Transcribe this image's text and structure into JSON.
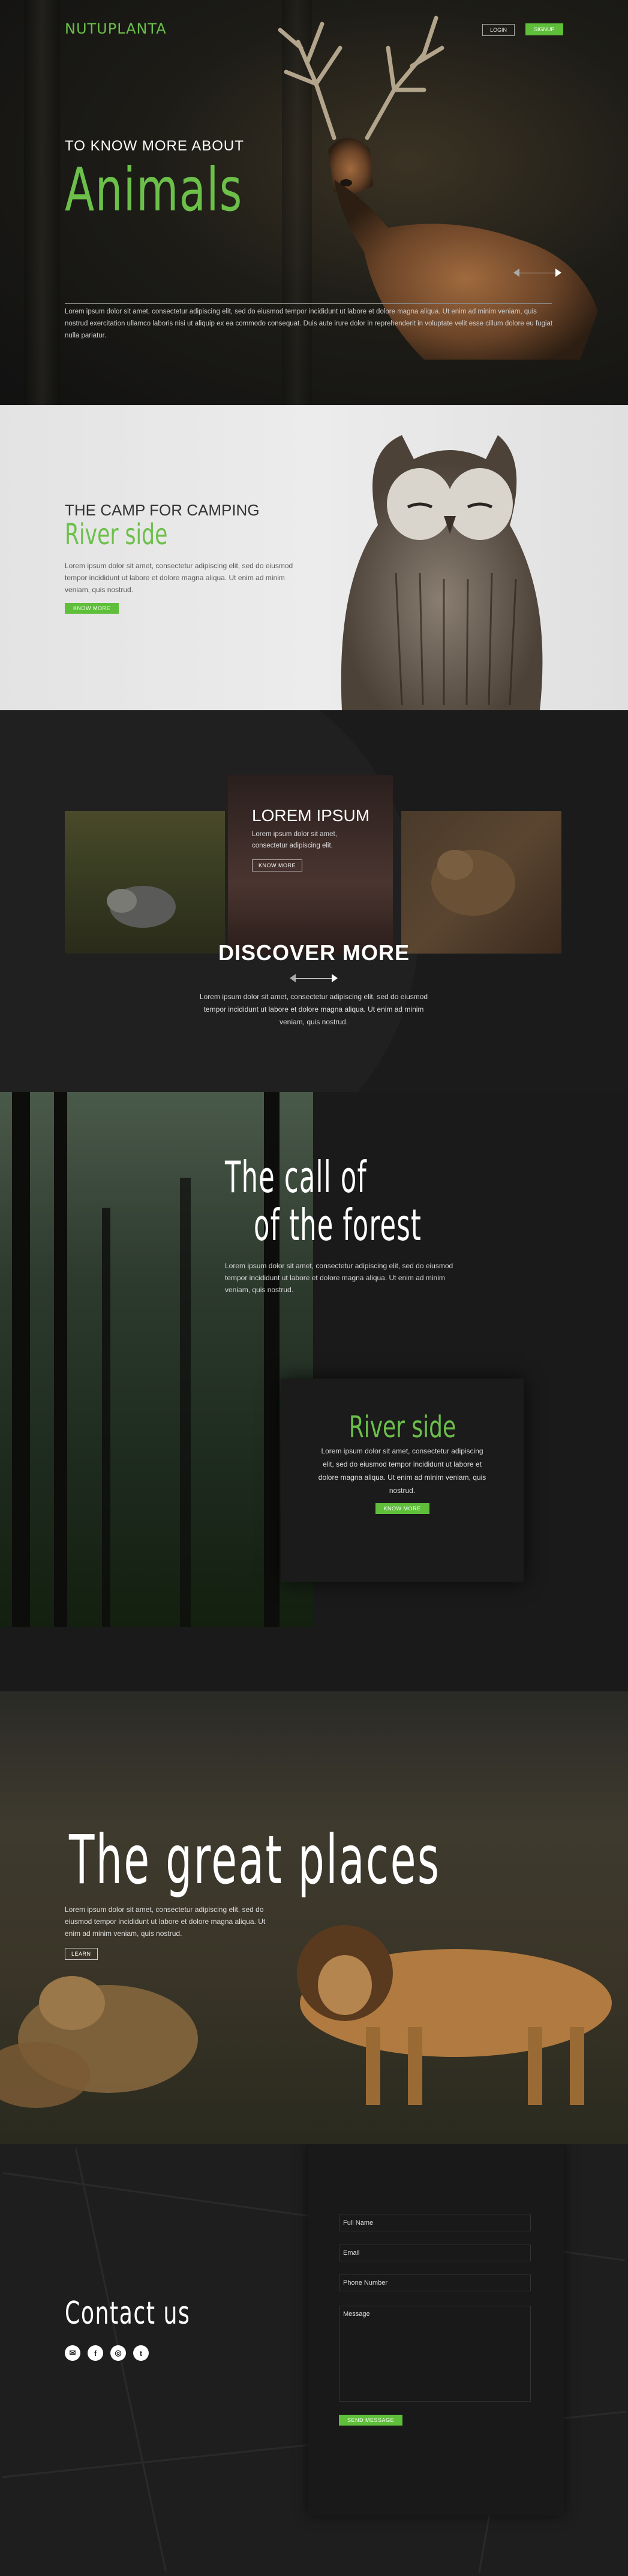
{
  "brand": {
    "logo": "NUTUPLANTA",
    "accent": "#5fbf3a"
  },
  "nav": {
    "login": "LOGIN",
    "signup": "SIGNUP"
  },
  "hero": {
    "subtitle": "TO KNOW MORE ABOUT",
    "title": "Animals",
    "paragraph": "Lorem ipsum dolor sit amet, consectetur adipiscing elit, sed do eiusmod tempor incididunt ut labore et dolore magna aliqua. Ut enim ad minim veniam, quis nostrud exercitation ullamco laboris nisi ut aliquip ex ea commodo consequat. Duis aute irure dolor in reprehenderit in voluptate velit esse cillum dolore eu fugiat nulla pariatur."
  },
  "owl": {
    "subtitle": "THE CAMP FOR CAMPING",
    "title": "River side",
    "paragraph": "Lorem ipsum dolor sit amet, consectetur adipiscing elit, sed do eiusmod tempor incididunt ut labore et dolore magna aliqua. Ut enim ad minim veniam, quis nostrud.",
    "button": "KNOW MORE"
  },
  "discover": {
    "card_title": "LOREM IPSUM",
    "card_paragraph": "Lorem ipsum dolor sit amet, consectetur adipiscing elit.",
    "card_button": "KNOW MORE",
    "title": "DISCOVER MORE",
    "paragraph": "Lorem ipsum dolor sit amet, consectetur adipiscing elit, sed do eiusmod tempor incididunt ut labore et dolore magna aliqua. Ut enim ad minim veniam, quis nostrud."
  },
  "forest": {
    "title_line1": "The call of",
    "title_line2": "of the forest",
    "paragraph": "Lorem ipsum dolor sit amet, consectetur adipiscing elit, sed do eiusmod tempor incididunt ut labore et dolore magna aliqua. Ut enim ad minim veniam, quis nostrud.",
    "box_title": "River side",
    "box_paragraph": "Lorem ipsum dolor sit amet, consectetur adipiscing elit, sed do eiusmod tempor incididunt ut labore et dolore magna aliqua. Ut enim ad minim veniam, quis nostrud.",
    "box_button": "KNOW MORE"
  },
  "places": {
    "title": "The great places",
    "paragraph": "Lorem ipsum dolor sit amet, consectetur adipiscing elit, sed do eiusmod tempor incididunt ut labore et dolore magna aliqua. Ut enim ad minim veniam, quis nostrud.",
    "button": "LEARN"
  },
  "contact": {
    "title": "Contact us",
    "socials": [
      "mail-icon",
      "facebook-icon",
      "instagram-icon",
      "twitter-icon"
    ],
    "fields": {
      "name": "Full Name",
      "email": "Email",
      "phone": "Phone Number",
      "message": "Message"
    },
    "send": "SEND MESSAGE"
  }
}
